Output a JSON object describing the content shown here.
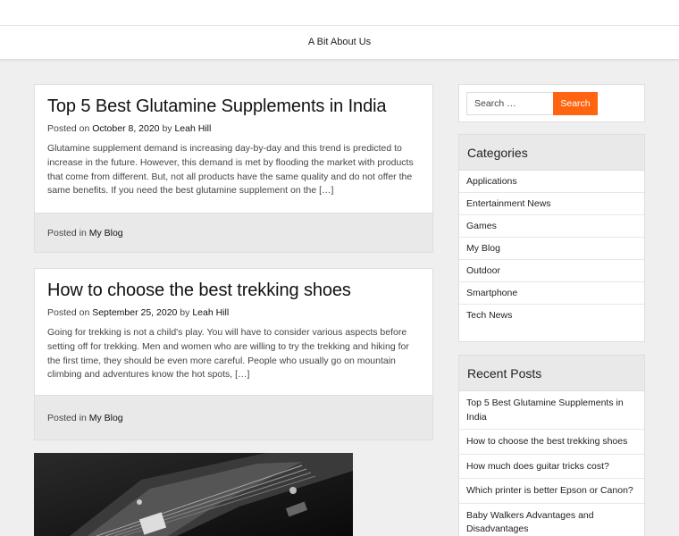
{
  "nav": {
    "about_label": "A Bit About Us"
  },
  "posts": [
    {
      "title": "Top 5 Best Glutamine Supplements in India",
      "posted_on": "Posted on",
      "date": "October 8, 2020",
      "by": "by",
      "author": "Leah Hill",
      "excerpt": "Glutamine supplement demand is increasing day-by-day and this trend is predicted to increase in the future. However, this demand is met by flooding the market with products that come from different. But, not all products have the same quality and do not offer the same benefits. If you need the best glutamine supplement on the […]",
      "posted_in": "Posted in",
      "category": "My Blog"
    },
    {
      "title": "How to choose the best trekking shoes",
      "posted_on": "Posted on",
      "date": "September 25, 2020",
      "by": "by",
      "author": "Leah Hill",
      "excerpt": "Going for trekking is not a child's play. You will have to consider various aspects before setting off for trekking. Men and women who are willing to try the trekking and hiking for the first time, they should be even more careful. People who usually go on mountain climbing and adventures know the hot spots, […]",
      "posted_in": "Posted in",
      "category": "My Blog"
    }
  ],
  "search": {
    "placeholder": "Search …",
    "button_label": "Search"
  },
  "categories": {
    "title": "Categories",
    "items": [
      "Applications",
      "Entertainment News",
      "Games",
      "My Blog",
      "Outdoor",
      "Smartphone",
      "Tech News"
    ]
  },
  "recent_posts": {
    "title": "Recent Posts",
    "items": [
      "Top 5 Best Glutamine Supplements in India",
      "How to choose the best trekking shoes",
      "How much does guitar tricks cost?",
      "Which printer is better Epson or Canon?",
      "Baby Walkers Advantages and Disadvantages"
    ]
  },
  "colors": {
    "accent": "#ff6410",
    "background": "#efefef",
    "card_footer": "#e9e9e9"
  }
}
